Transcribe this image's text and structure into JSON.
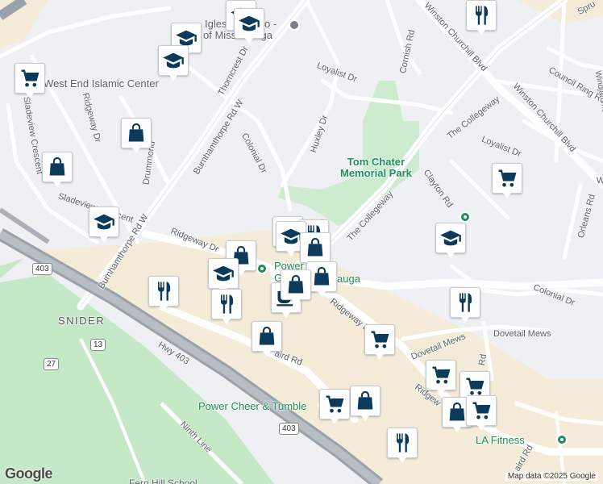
{
  "map": {
    "road_labels": {
      "winston_churchill_1": "Winston Churchill Blvd",
      "winston_churchill_2": "Winston Churchill Blvd",
      "cornish": "Cornish Rd",
      "loyalist_1": "Loyalist Dr",
      "loyalist_2": "Loyalist Dr",
      "council_ring": "Council Ring Rd",
      "thorncrest": "Thorncrest Dr",
      "burnhamthorpe_1": "Burnhamthorpe Rd W",
      "burnhamthorpe_2": "Burnhamthorpe Rd W",
      "colonial_1": "Colonial Dr",
      "colonial_2": "Colonial Dr",
      "huxley": "Huxley Dr",
      "the_collegeway_1": "The Collegeway",
      "the_collegeway_2": "The Collegeway",
      "clayton": "Clayton Rd",
      "orleans": "Orleans Rd",
      "ridgeway_1": "Ridgeway Dr",
      "ridgeway_2": "Ridgeway Dr",
      "ridgeway_3": "Ridgeway Dr",
      "ridgeway_4": "Ridgew",
      "dovetail_1": "Dovetail Mews",
      "dovetail_2": "Dovetail Mews",
      "sladeview": "Sladeview Crescent",
      "sladeview_2": "Sladeview Crescent",
      "drummond": "Drummond",
      "hwy403": "Hwy 403",
      "ninth_line": "Ninth Line",
      "laird_1": "aird Rd",
      "laird_2": "aird Rd",
      "sprucedale": "Spru",
      "windgammer": "Windjammer",
      "ridgeway_rd": "Rd",
      "orleans_partial": "W"
    },
    "place_labels": {
      "west_end_islamic": "West End Islamic Center",
      "iglesia": "Iglesia",
      "iglesia_2": "o -",
      "of_miss": "of Mississauga",
      "tom_chater": "Tom Chater\nMemorial Park",
      "power_g": "Power G",
      "auga": "auga",
      "power_cheer": "Power Cheer & Tumble",
      "la_fitness": "LA Fitness",
      "snider": "SNIDER",
      "fern_hill": "Fern Hill School"
    },
    "shields": {
      "s403_a": "403",
      "s403_b": "403",
      "s13": "13",
      "s27": "27"
    },
    "colors": {
      "background": "#eef0f3",
      "commercial": "#f4ecd8",
      "park": "#cdeccf",
      "green_area": "#c5e8c6",
      "highway": "#9aa1ab",
      "poi_green": "#1e8e5a",
      "pin_icon": "#0b3a5a"
    },
    "markers": [
      {
        "name": "grocery-marker",
        "icon": "cart"
      },
      {
        "name": "school-marker",
        "icon": "school"
      },
      {
        "name": "school-marker",
        "icon": "school"
      },
      {
        "name": "school-marker",
        "icon": "school"
      },
      {
        "name": "school-marker",
        "icon": "school"
      },
      {
        "name": "shopping-marker",
        "icon": "bag"
      },
      {
        "name": "shopping-marker",
        "icon": "bag"
      },
      {
        "name": "school-marker",
        "icon": "school"
      },
      {
        "name": "shopping-marker",
        "icon": "bag"
      },
      {
        "name": "school-marker",
        "icon": "school"
      },
      {
        "name": "restaurant-marker",
        "icon": "fork"
      },
      {
        "name": "restaurant-marker",
        "icon": "fork"
      },
      {
        "name": "restaurant-marker",
        "icon": "fork"
      },
      {
        "name": "restaurant-marker",
        "icon": "fork"
      },
      {
        "name": "school-marker",
        "icon": "school"
      },
      {
        "name": "shopping-marker",
        "icon": "bag"
      },
      {
        "name": "shopping-marker",
        "icon": "bag"
      },
      {
        "name": "cafe-marker",
        "icon": "cup"
      },
      {
        "name": "shopping-marker",
        "icon": "bag"
      },
      {
        "name": "shopping-marker",
        "icon": "bag"
      },
      {
        "name": "grocery-marker",
        "icon": "cart"
      },
      {
        "name": "school-marker",
        "icon": "school"
      },
      {
        "name": "restaurant-marker",
        "icon": "fork"
      },
      {
        "name": "grocery-marker",
        "icon": "cart"
      },
      {
        "name": "restaurant-marker",
        "icon": "fork"
      },
      {
        "name": "shopping-marker",
        "icon": "bag"
      },
      {
        "name": "grocery-marker",
        "icon": "cart"
      },
      {
        "name": "grocery-marker",
        "icon": "cart"
      },
      {
        "name": "grocery-marker",
        "icon": "cart"
      },
      {
        "name": "shopping-marker",
        "icon": "bag"
      },
      {
        "name": "grocery-marker",
        "icon": "cart"
      },
      {
        "name": "restaurant-marker",
        "icon": "fork"
      }
    ],
    "attribution": "Map data ©2025 Google",
    "logo": "Google"
  }
}
